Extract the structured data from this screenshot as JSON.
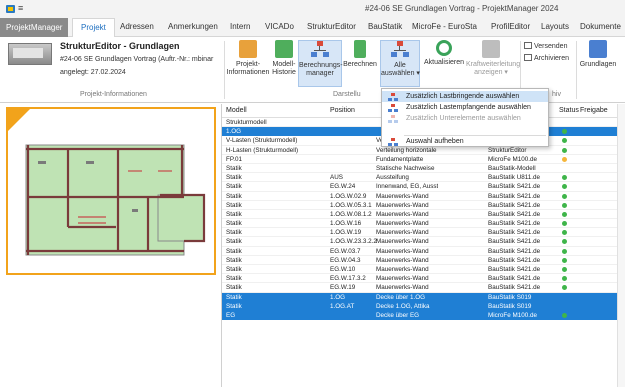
{
  "window": {
    "title": "#24-06 SE Grundlagen Vortrag - ProjektManager 2024"
  },
  "tabs": [
    {
      "label": "ProjektManager"
    },
    {
      "label": "Projekt"
    },
    {
      "label": "Adressen"
    },
    {
      "label": "Anmerkungen"
    },
    {
      "label": "Intern"
    },
    {
      "label": "VICADo"
    },
    {
      "label": "StrukturEditor"
    },
    {
      "label": "BauStatik"
    },
    {
      "label": "MicroFe - EuroSta"
    },
    {
      "label": "ProfilEditor"
    },
    {
      "label": "Layouts"
    },
    {
      "label": "Dokumente"
    }
  ],
  "project_info": {
    "title": "StrukturEditor - Grundlagen",
    "description": "#24-06 SE Grundlagen Vortrag (Auftr.-Nr.: mbinar",
    "date": "angelegt: 27.02.2024",
    "group_label": "Projekt-Informationen"
  },
  "ribbon": {
    "btn_info": "Projekt-",
    "btn_info2": "Informationen",
    "btn_modell": "Modell-",
    "btn_modell2": "Historie",
    "btn_calc": "Berechnungs-",
    "btn_calc2": "manager",
    "btn_berechnen": "Berechnen",
    "btn_alle": "Alle",
    "btn_alle2": "auswählen ▾",
    "btn_aktual": "Aktualisieren",
    "btn_kraft": "Kraftweiterleitung",
    "btn_kraft2": "anzeigen ▾",
    "btn_versenden": "Versenden",
    "btn_archivieren": "Archivieren",
    "btn_grundlagen": "Grundlagen",
    "group_darstellung": "Darstellu",
    "group_archiv": "hiv"
  },
  "dropdown": {
    "items": [
      {
        "label": "Zusätzlich Lastbringende auswählen"
      },
      {
        "label": "Zusätzlich Lastempfangende auswählen"
      },
      {
        "label": "Zusätzlich Unterelemente auswählen"
      },
      {
        "label": "Auswahl aufheben"
      }
    ]
  },
  "grid": {
    "headers": {
      "modell": "Modell",
      "position": "Position",
      "status": "Status",
      "freigabe": "Freigabe"
    },
    "rows": [
      {
        "modell": "Strukturmodell",
        "position": "",
        "bez": "",
        "prog": "",
        "status": ""
      },
      {
        "modell": "1.OG",
        "position": "",
        "bez": "",
        "prog": "",
        "status": "green",
        "selected": true
      },
      {
        "modell": "V-Lasten (Strukturmodell)",
        "position": "",
        "bez": "Verteilung vertikale Lasten",
        "prog": "StrukturEditor",
        "status": "green"
      },
      {
        "modell": "H-Lasten (Strukturmodell)",
        "position": "",
        "bez": "Verteilung horizontale Last...",
        "prog": "StrukturEditor",
        "status": "green"
      },
      {
        "modell": "FP.01",
        "position": "",
        "bez": "Fundamentplatte",
        "prog": "MicroFe M100.de",
        "status": "orange"
      },
      {
        "modell": "Statik",
        "position": "",
        "bez": "Statische Nachweise",
        "prog": "BauStatik-Modell",
        "status": ""
      },
      {
        "modell": "Statik",
        "position": "AUS",
        "bez": "Aussteifung",
        "prog": "BauStatik U811.de",
        "status": "green"
      },
      {
        "modell": "Statik",
        "position": "EG.W.24",
        "bez": "Innenwand, EG, Aussteifung",
        "prog": "BauStatik S421.de",
        "status": "green"
      },
      {
        "modell": "Statik",
        "position": "1.OG.W.02.9",
        "bez": "Mauerwerks-Wand",
        "prog": "BauStatik S421.de",
        "status": "green"
      },
      {
        "modell": "Statik",
        "position": "1.OG.W.05.3.1",
        "bez": "Mauerwerks-Wand",
        "prog": "BauStatik S421.de",
        "status": "green"
      },
      {
        "modell": "Statik",
        "position": "1.OG.W.08.1.2",
        "bez": "Mauerwerks-Wand",
        "prog": "BauStatik S421.de",
        "status": "green"
      },
      {
        "modell": "Statik",
        "position": "1.OG.W.16",
        "bez": "Mauerwerks-Wand",
        "prog": "BauStatik S421.de",
        "status": "green"
      },
      {
        "modell": "Statik",
        "position": "1.OG.W.19",
        "bez": "Mauerwerks-Wand",
        "prog": "BauStatik S421.de",
        "status": "green"
      },
      {
        "modell": "Statik",
        "position": "1.OG.W.23.3.2.2",
        "bez": "Mauerwerks-Wand",
        "prog": "BauStatik S421.de",
        "status": "green"
      },
      {
        "modell": "Statik",
        "position": "EG.W.03.7",
        "bez": "Mauerwerks-Wand",
        "prog": "BauStatik S421.de",
        "status": "green"
      },
      {
        "modell": "Statik",
        "position": "EG.W.04.3",
        "bez": "Mauerwerks-Wand",
        "prog": "BauStatik S421.de",
        "status": "green"
      },
      {
        "modell": "Statik",
        "position": "EG.W.10",
        "bez": "Mauerwerks-Wand",
        "prog": "BauStatik S421.de",
        "status": "green"
      },
      {
        "modell": "Statik",
        "position": "EG.W.17.3.2",
        "bez": "Mauerwerks-Wand",
        "prog": "BauStatik S421.de",
        "status": "green"
      },
      {
        "modell": "Statik",
        "position": "EG.W.19",
        "bez": "Mauerwerks-Wand",
        "prog": "BauStatik S421.de",
        "status": "green"
      },
      {
        "modell": "Statik",
        "position": "1.OG",
        "bez": "Decke über 1.OG",
        "prog": "BauStatik S019",
        "status": "",
        "selected": true
      },
      {
        "modell": "Statik",
        "position": "1.OG.AT",
        "bez": "Decke 1.OG, Attika",
        "prog": "BauStatik S019",
        "status": "",
        "selected": true
      },
      {
        "modell": "EG",
        "position": "",
        "bez": "Decke über EG",
        "prog": "MicroFe M100.de",
        "status": "green",
        "selected": true
      }
    ]
  },
  "colors": {
    "selection": "#1f7fd4",
    "status_ok": "#3fb54a",
    "status_warn": "#f5b63a",
    "preview_border": "#f2a31b",
    "slab_fill": "#bfe3b4"
  }
}
